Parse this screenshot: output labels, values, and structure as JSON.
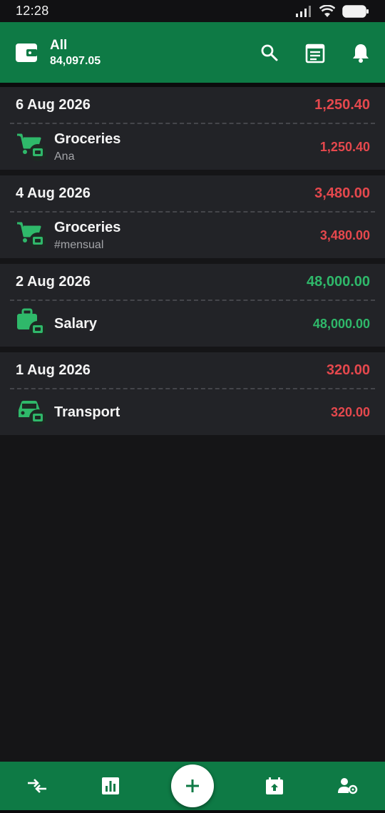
{
  "status_bar": {
    "time": "12:28"
  },
  "header": {
    "account_name": "All",
    "account_balance": "84,097.05",
    "icons": [
      "wallet-icon",
      "search-icon",
      "calendar-notes-icon",
      "bell-icon"
    ]
  },
  "colors": {
    "brand": "#0e7a45",
    "expense": "#e5484d",
    "income": "#2fb86a",
    "card": "#222327",
    "background": "#151517"
  },
  "groups": [
    {
      "date": "6 Aug 2026",
      "total": "1,250.40",
      "total_type": "expense",
      "transactions": [
        {
          "category": "Groceries",
          "subtitle": "Ana",
          "amount": "1,250.40",
          "type": "expense",
          "icon": "cart-icon"
        }
      ]
    },
    {
      "date": "4 Aug 2026",
      "total": "3,480.00",
      "total_type": "expense",
      "transactions": [
        {
          "category": "Groceries",
          "subtitle": "#mensual",
          "amount": "3,480.00",
          "type": "expense",
          "icon": "cart-icon"
        }
      ]
    },
    {
      "date": "2 Aug 2026",
      "total": "48,000.00",
      "total_type": "income",
      "transactions": [
        {
          "category": "Salary",
          "subtitle": "",
          "amount": "48,000.00",
          "type": "income",
          "icon": "briefcase-icon"
        }
      ]
    },
    {
      "date": "1 Aug 2026",
      "total": "320.00",
      "total_type": "expense",
      "transactions": [
        {
          "category": "Transport",
          "subtitle": "",
          "amount": "320.00",
          "type": "expense",
          "icon": "car-icon"
        }
      ]
    }
  ],
  "bottom_nav": {
    "items": [
      "transfer-icon",
      "stats-icon",
      "add-icon",
      "scheduled-icon",
      "account-settings-icon"
    ]
  }
}
